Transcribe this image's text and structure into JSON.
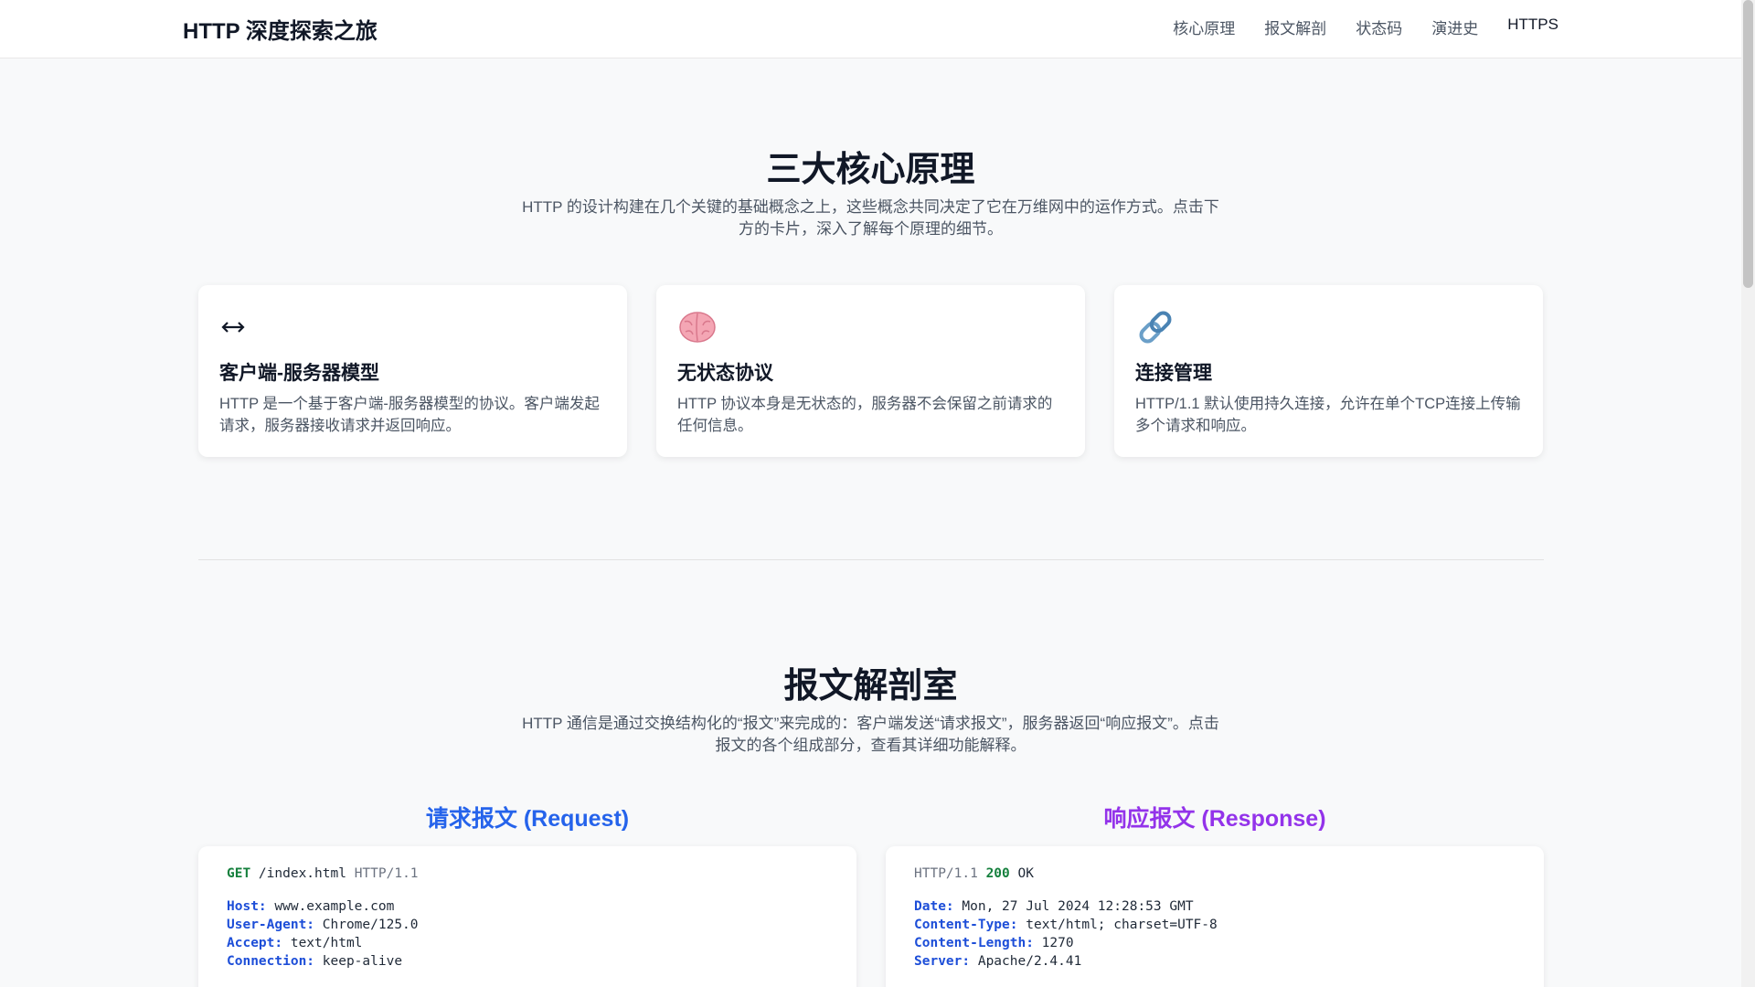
{
  "nav": {
    "brand": "HTTP 深度探索之旅",
    "links": [
      "核心原理",
      "报文解剖",
      "状态码",
      "演进史",
      "HTTPS"
    ]
  },
  "principles": {
    "title": "三大核心原理",
    "desc": "HTTP 的设计构建在几个关键的基础概念之上，这些概念共同决定了它在万维网中的运作方式。点击下方的卡片，深入了解每个原理的细节。",
    "cards": [
      {
        "icon": "↔",
        "icon_name": "bidirectional-arrow-icon",
        "title": "客户端-服务器模型",
        "text": "HTTP 是一个基于客户端-服务器模型的协议。客户端发起请求，服务器接收请求并返回响应。"
      },
      {
        "icon": "🧠",
        "icon_name": "brain-icon",
        "title": "无状态协议",
        "text": "HTTP 协议本身是无状态的，服务器不会保留之前请求的任何信息。"
      },
      {
        "icon": "🔗",
        "icon_name": "link-icon",
        "title": "连接管理",
        "text": "HTTP/1.1 默认使用持久连接，允许在单个TCP连接上传输多个请求和响应。"
      }
    ]
  },
  "anatomy": {
    "title": "报文解剖室",
    "desc": "HTTP 通信是通过交换结构化的“报文”来完成的：客户端发送“请求报文”，服务器返回“响应报文”。点击报文的各个组成部分，查看其详细功能解释。",
    "request": {
      "heading": "请求报文 (Request)",
      "method": "GET",
      "path": " /index.html ",
      "version": "HTTP/1.1",
      "headers": [
        {
          "key": "Host:",
          "value": " www.example.com"
        },
        {
          "key": "User-Agent:",
          "value": " Chrome/125.0"
        },
        {
          "key": "Accept:",
          "value": " text/html"
        },
        {
          "key": "Connection:",
          "value": " keep-alive"
        }
      ]
    },
    "response": {
      "heading": "响应报文 (Response)",
      "version": "HTTP/1.1",
      "status_code": " 200",
      "status_text": " OK",
      "headers": [
        {
          "key": "Date:",
          "value": " Mon, 27 Jul 2024 12:28:53 GMT"
        },
        {
          "key": "Content-Type:",
          "value": " text/html; charset=UTF-8"
        },
        {
          "key": "Content-Length:",
          "value": " 1270"
        },
        {
          "key": "Server:",
          "value": " Apache/2.4.41"
        }
      ]
    }
  },
  "colors": {
    "request_accent": "#2563eb",
    "response_accent": "#9333ea",
    "keyword_green": "#15803d",
    "header_key_blue": "#1d4ed8"
  }
}
